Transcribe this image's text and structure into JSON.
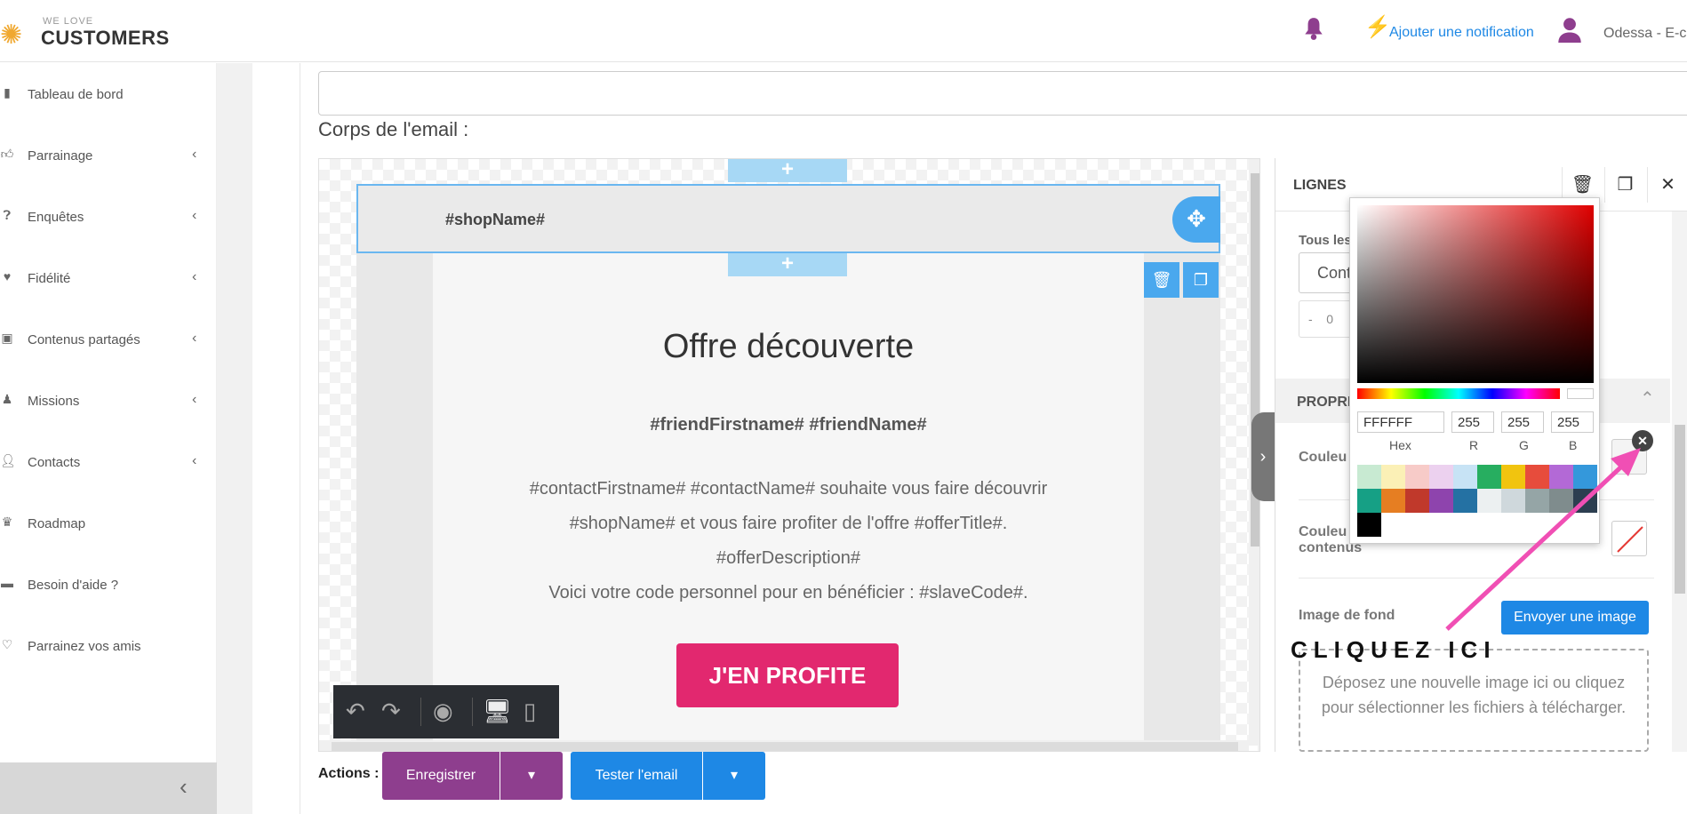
{
  "header": {
    "logo_small": "WE LOVE",
    "logo_big": "CUSTOMERS",
    "notification_link": "Ajouter une notification",
    "username": "Odessa - E-co"
  },
  "sidebar": {
    "items": [
      {
        "label": "Tableau de bord",
        "icon": "bar-chart-icon",
        "chevron": false
      },
      {
        "label": "Parrainage",
        "icon": "thumbs-up-icon",
        "chevron": true
      },
      {
        "label": "Enquêtes",
        "icon": "question-icon",
        "chevron": true
      },
      {
        "label": "Fidélité",
        "icon": "heart-icon",
        "chevron": true
      },
      {
        "label": "Contenus partagés",
        "icon": "image-icon",
        "chevron": true
      },
      {
        "label": "Missions",
        "icon": "chess-icon",
        "chevron": true
      },
      {
        "label": "Contacts",
        "icon": "user-icon",
        "chevron": true
      },
      {
        "label": "Roadmap",
        "icon": "crown-icon",
        "chevron": false
      },
      {
        "label": "Besoin d'aide ?",
        "icon": "briefcase-icon",
        "chevron": false
      },
      {
        "label": "Parrainez vos amis",
        "icon": "heart-outline-icon",
        "chevron": false
      }
    ]
  },
  "main": {
    "section_label": "Corps de l'email :"
  },
  "email": {
    "shop_name": "#shopName#",
    "title": "Offre découverte",
    "friend_line": "#friendFirstname# #friendName#",
    "para_lines": [
      "#contactFirstname# #contactName# souhaite vous faire découvrir",
      "#shopName# et vous faire profiter de l'offre #offerTitle#.",
      "#offerDescription#",
      "Voici votre code personnel pour en bénéficier : #slaveCode#."
    ],
    "cta": "J'EN PROFITE"
  },
  "panel": {
    "title": "LIGNES",
    "tous_label": "Tous les",
    "select_value": "Cont",
    "number_minus": "-",
    "number_value": "0",
    "props_title": "PROPRI",
    "couleur_label": "Couleu",
    "couleur_contenu_l1": "Couleu",
    "couleur_contenu_l2": "contenus",
    "image_label": "Image de fond",
    "upload_label": "Envoyer une image",
    "drop_text": "Déposez une nouvelle image ici ou cliquez pour sélectionner les fichiers à télécharger."
  },
  "picker": {
    "hex": "FFFFFF",
    "r": "255",
    "g": "255",
    "b": "255",
    "labels": {
      "hex": "Hex",
      "r": "R",
      "g": "G",
      "b": "B"
    },
    "palette": [
      "#c8ead2",
      "#fbf0b6",
      "#f7cbc8",
      "#ecd1ef",
      "#c7e3f5",
      "#27ae60",
      "#f1c40f",
      "#e74c3c",
      "#b369d6",
      "#3498db",
      "#16a085",
      "#e67e22",
      "#c0392b",
      "#8e44ad",
      "#2471a3",
      "#ecf0f1",
      "#cfd8dc",
      "#95a5a6",
      "#7f8c8d",
      "#2c3e50",
      "#000000",
      "#ffffff"
    ]
  },
  "actions": {
    "label": "Actions :",
    "save": "Enregistrer",
    "test": "Tester l'email"
  },
  "annotation": {
    "text": "CLIQUEZ ICI",
    "color": "#f04fb4"
  },
  "colors": {
    "accent_purple": "#8e3e8e",
    "accent_blue": "#1e88e5",
    "cta_pink": "#e2286f"
  }
}
